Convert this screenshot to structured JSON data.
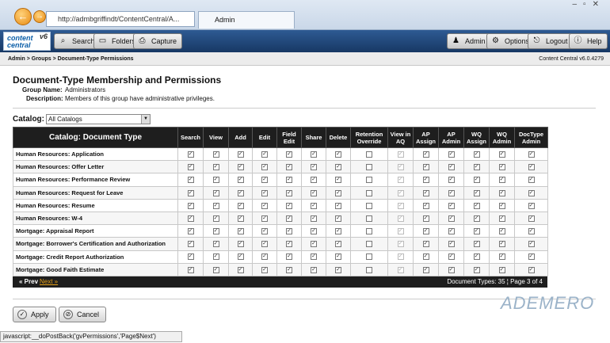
{
  "browser": {
    "url": "http://admbgriffindt/ContentCentral/A...",
    "tab_title": "Admin"
  },
  "header": {
    "logo_text": "content central",
    "logo_version": "v6",
    "search": "Search",
    "folders": "Folders",
    "capture": "Capture",
    "admin": "Admin",
    "options": "Options",
    "logout": "Logout",
    "help": "Help"
  },
  "breadcrumb": "Admin > Groups > Document-Type Permissions",
  "version": "Content Central v6.0.4279",
  "page": {
    "title": "Document-Type Membership and Permissions",
    "group_label": "Group Name:",
    "group_value": "Administrators",
    "desc_label": "Description:",
    "desc_value": "Members of this group have administrative privileges."
  },
  "catalog": {
    "label": "Catalog:",
    "selected": "All Catalogs"
  },
  "grid": {
    "headers": [
      "Catalog: Document Type",
      "Search",
      "View",
      "Add",
      "Edit",
      "Field Edit",
      "Share",
      "Delete",
      "Retention Override",
      "View in AQ",
      "AP Assign",
      "AP Admin",
      "WQ Assign",
      "WQ Admin",
      "DocType Admin"
    ],
    "rows": [
      {
        "name": "Human Resources: Application",
        "checks": [
          1,
          1,
          1,
          1,
          1,
          1,
          1,
          0,
          1,
          1,
          1,
          1,
          1,
          1
        ]
      },
      {
        "name": "Human Resources: Offer Letter",
        "checks": [
          1,
          1,
          1,
          1,
          1,
          1,
          1,
          0,
          1,
          1,
          1,
          1,
          1,
          1
        ]
      },
      {
        "name": "Human Resources: Performance Review",
        "checks": [
          1,
          1,
          1,
          1,
          1,
          1,
          1,
          0,
          1,
          1,
          1,
          1,
          1,
          1
        ]
      },
      {
        "name": "Human Resources: Request for Leave",
        "checks": [
          1,
          1,
          1,
          1,
          1,
          1,
          1,
          0,
          1,
          1,
          1,
          1,
          1,
          1
        ]
      },
      {
        "name": "Human Resources: Resume",
        "checks": [
          1,
          1,
          1,
          1,
          1,
          1,
          1,
          0,
          1,
          1,
          1,
          1,
          1,
          1
        ]
      },
      {
        "name": "Human Resources: W-4",
        "checks": [
          1,
          1,
          1,
          1,
          1,
          1,
          1,
          0,
          1,
          1,
          1,
          1,
          1,
          1
        ]
      },
      {
        "name": "Mortgage: Appraisal Report",
        "checks": [
          1,
          1,
          1,
          1,
          1,
          1,
          1,
          0,
          1,
          1,
          1,
          1,
          1,
          1
        ]
      },
      {
        "name": "Mortgage: Borrower's Certification and Authorization",
        "checks": [
          1,
          1,
          1,
          1,
          1,
          1,
          1,
          0,
          1,
          1,
          1,
          1,
          1,
          1
        ]
      },
      {
        "name": "Mortgage: Credit Report Authorization",
        "checks": [
          1,
          1,
          1,
          1,
          1,
          1,
          1,
          0,
          1,
          1,
          1,
          1,
          1,
          1
        ]
      },
      {
        "name": "Mortgage: Good Faith Estimate",
        "checks": [
          1,
          1,
          1,
          1,
          1,
          1,
          1,
          0,
          1,
          1,
          1,
          1,
          1,
          1
        ]
      }
    ]
  },
  "pager": {
    "prev": "« Prev",
    "next": "Next »",
    "info": "Document Types: 35 ¦ Page 3 of 4"
  },
  "buttons": {
    "apply": "Apply",
    "cancel": "Cancel"
  },
  "brand": "ADEMERO",
  "status": "javascript:__doPostBack('gvPermissions','Page$Next')"
}
